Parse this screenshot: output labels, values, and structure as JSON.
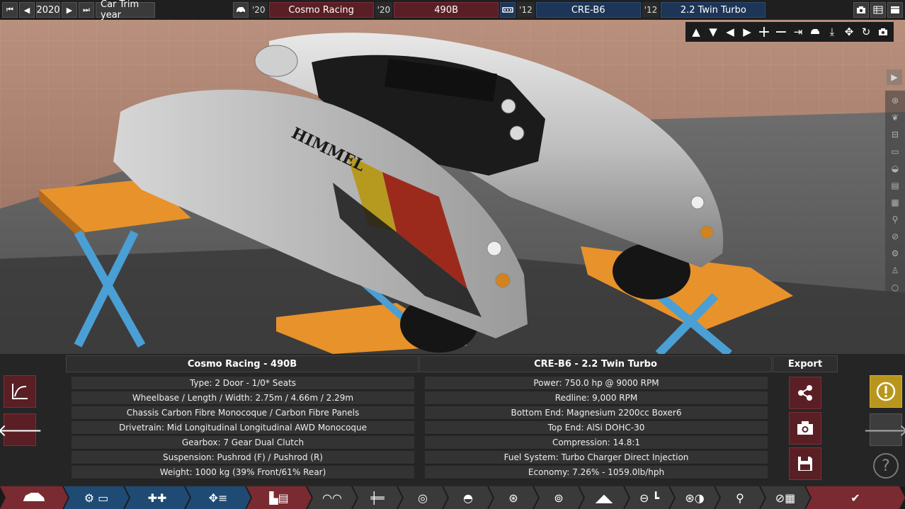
{
  "topbar": {
    "year": "2020",
    "trim_label": "Car Trim year",
    "car_year_short": "'20",
    "company": "Cosmo Racing",
    "model_year_short": "'20",
    "model": "490B",
    "engine_year_short": "'12",
    "engine_family": "CRE-B6",
    "variant_year_short": "'12",
    "variant": "2.2 Twin Turbo"
  },
  "left_panel": {
    "title": "Cosmo Racing - 490B",
    "rows": [
      "Type: 2 Door - 1/0* Seats",
      "Wheelbase / Length / Width: 2.75m / 4.66m / 2.29m",
      "Chassis Carbon Fibre Monocoque / Carbon Fibre Panels",
      "Drivetrain: Mid Longitudinal Longitudinal AWD Monocoque",
      "Gearbox: 7 Gear Dual Clutch",
      "Suspension: Pushrod (F) / Pushrod (R)",
      "Weight: 1000 kg (39% Front/61% Rear)"
    ]
  },
  "right_panel": {
    "title": "CRE-B6 - 2.2 Twin Turbo",
    "rows": [
      "Power: 750.0 hp @ 9000 RPM",
      "Redline:  9,000 RPM",
      "Bottom End: Magnesium 2200cc Boxer6",
      "Top End: AlSi DOHC-30",
      "Compression: 14.8:1",
      "Fuel System: Turbo Charger Direct Injection",
      "Economy: 7.26% - 1059.0lb/hph"
    ]
  },
  "export": {
    "title": "Export"
  },
  "car_graphics": {
    "brand": "HIMMEL",
    "accent_colors": [
      "#b69a1f",
      "#9c2a1c",
      "#1a1a1a"
    ]
  },
  "colors": {
    "accent_red": "#5a1f24",
    "accent_blue": "#1d3557",
    "accent_gold": "#b8961e"
  }
}
